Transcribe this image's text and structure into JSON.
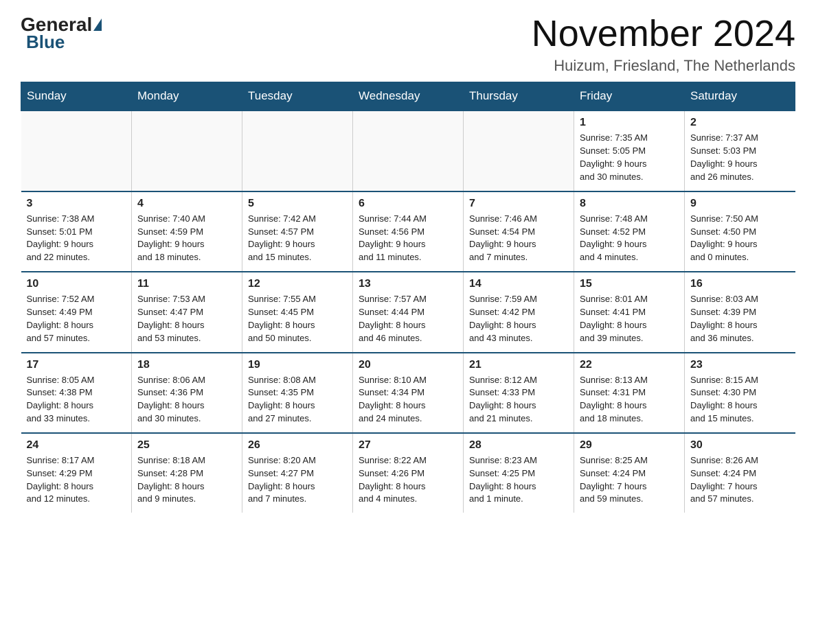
{
  "logo": {
    "general": "General",
    "blue": "Blue",
    "subtitle": "Blue"
  },
  "header": {
    "month": "November 2024",
    "location": "Huizum, Friesland, The Netherlands"
  },
  "days_of_week": [
    "Sunday",
    "Monday",
    "Tuesday",
    "Wednesday",
    "Thursday",
    "Friday",
    "Saturday"
  ],
  "weeks": [
    [
      {
        "day": "",
        "info": ""
      },
      {
        "day": "",
        "info": ""
      },
      {
        "day": "",
        "info": ""
      },
      {
        "day": "",
        "info": ""
      },
      {
        "day": "",
        "info": ""
      },
      {
        "day": "1",
        "info": "Sunrise: 7:35 AM\nSunset: 5:05 PM\nDaylight: 9 hours\nand 30 minutes."
      },
      {
        "day": "2",
        "info": "Sunrise: 7:37 AM\nSunset: 5:03 PM\nDaylight: 9 hours\nand 26 minutes."
      }
    ],
    [
      {
        "day": "3",
        "info": "Sunrise: 7:38 AM\nSunset: 5:01 PM\nDaylight: 9 hours\nand 22 minutes."
      },
      {
        "day": "4",
        "info": "Sunrise: 7:40 AM\nSunset: 4:59 PM\nDaylight: 9 hours\nand 18 minutes."
      },
      {
        "day": "5",
        "info": "Sunrise: 7:42 AM\nSunset: 4:57 PM\nDaylight: 9 hours\nand 15 minutes."
      },
      {
        "day": "6",
        "info": "Sunrise: 7:44 AM\nSunset: 4:56 PM\nDaylight: 9 hours\nand 11 minutes."
      },
      {
        "day": "7",
        "info": "Sunrise: 7:46 AM\nSunset: 4:54 PM\nDaylight: 9 hours\nand 7 minutes."
      },
      {
        "day": "8",
        "info": "Sunrise: 7:48 AM\nSunset: 4:52 PM\nDaylight: 9 hours\nand 4 minutes."
      },
      {
        "day": "9",
        "info": "Sunrise: 7:50 AM\nSunset: 4:50 PM\nDaylight: 9 hours\nand 0 minutes."
      }
    ],
    [
      {
        "day": "10",
        "info": "Sunrise: 7:52 AM\nSunset: 4:49 PM\nDaylight: 8 hours\nand 57 minutes."
      },
      {
        "day": "11",
        "info": "Sunrise: 7:53 AM\nSunset: 4:47 PM\nDaylight: 8 hours\nand 53 minutes."
      },
      {
        "day": "12",
        "info": "Sunrise: 7:55 AM\nSunset: 4:45 PM\nDaylight: 8 hours\nand 50 minutes."
      },
      {
        "day": "13",
        "info": "Sunrise: 7:57 AM\nSunset: 4:44 PM\nDaylight: 8 hours\nand 46 minutes."
      },
      {
        "day": "14",
        "info": "Sunrise: 7:59 AM\nSunset: 4:42 PM\nDaylight: 8 hours\nand 43 minutes."
      },
      {
        "day": "15",
        "info": "Sunrise: 8:01 AM\nSunset: 4:41 PM\nDaylight: 8 hours\nand 39 minutes."
      },
      {
        "day": "16",
        "info": "Sunrise: 8:03 AM\nSunset: 4:39 PM\nDaylight: 8 hours\nand 36 minutes."
      }
    ],
    [
      {
        "day": "17",
        "info": "Sunrise: 8:05 AM\nSunset: 4:38 PM\nDaylight: 8 hours\nand 33 minutes."
      },
      {
        "day": "18",
        "info": "Sunrise: 8:06 AM\nSunset: 4:36 PM\nDaylight: 8 hours\nand 30 minutes."
      },
      {
        "day": "19",
        "info": "Sunrise: 8:08 AM\nSunset: 4:35 PM\nDaylight: 8 hours\nand 27 minutes."
      },
      {
        "day": "20",
        "info": "Sunrise: 8:10 AM\nSunset: 4:34 PM\nDaylight: 8 hours\nand 24 minutes."
      },
      {
        "day": "21",
        "info": "Sunrise: 8:12 AM\nSunset: 4:33 PM\nDaylight: 8 hours\nand 21 minutes."
      },
      {
        "day": "22",
        "info": "Sunrise: 8:13 AM\nSunset: 4:31 PM\nDaylight: 8 hours\nand 18 minutes."
      },
      {
        "day": "23",
        "info": "Sunrise: 8:15 AM\nSunset: 4:30 PM\nDaylight: 8 hours\nand 15 minutes."
      }
    ],
    [
      {
        "day": "24",
        "info": "Sunrise: 8:17 AM\nSunset: 4:29 PM\nDaylight: 8 hours\nand 12 minutes."
      },
      {
        "day": "25",
        "info": "Sunrise: 8:18 AM\nSunset: 4:28 PM\nDaylight: 8 hours\nand 9 minutes."
      },
      {
        "day": "26",
        "info": "Sunrise: 8:20 AM\nSunset: 4:27 PM\nDaylight: 8 hours\nand 7 minutes."
      },
      {
        "day": "27",
        "info": "Sunrise: 8:22 AM\nSunset: 4:26 PM\nDaylight: 8 hours\nand 4 minutes."
      },
      {
        "day": "28",
        "info": "Sunrise: 8:23 AM\nSunset: 4:25 PM\nDaylight: 8 hours\nand 1 minute."
      },
      {
        "day": "29",
        "info": "Sunrise: 8:25 AM\nSunset: 4:24 PM\nDaylight: 7 hours\nand 59 minutes."
      },
      {
        "day": "30",
        "info": "Sunrise: 8:26 AM\nSunset: 4:24 PM\nDaylight: 7 hours\nand 57 minutes."
      }
    ]
  ]
}
